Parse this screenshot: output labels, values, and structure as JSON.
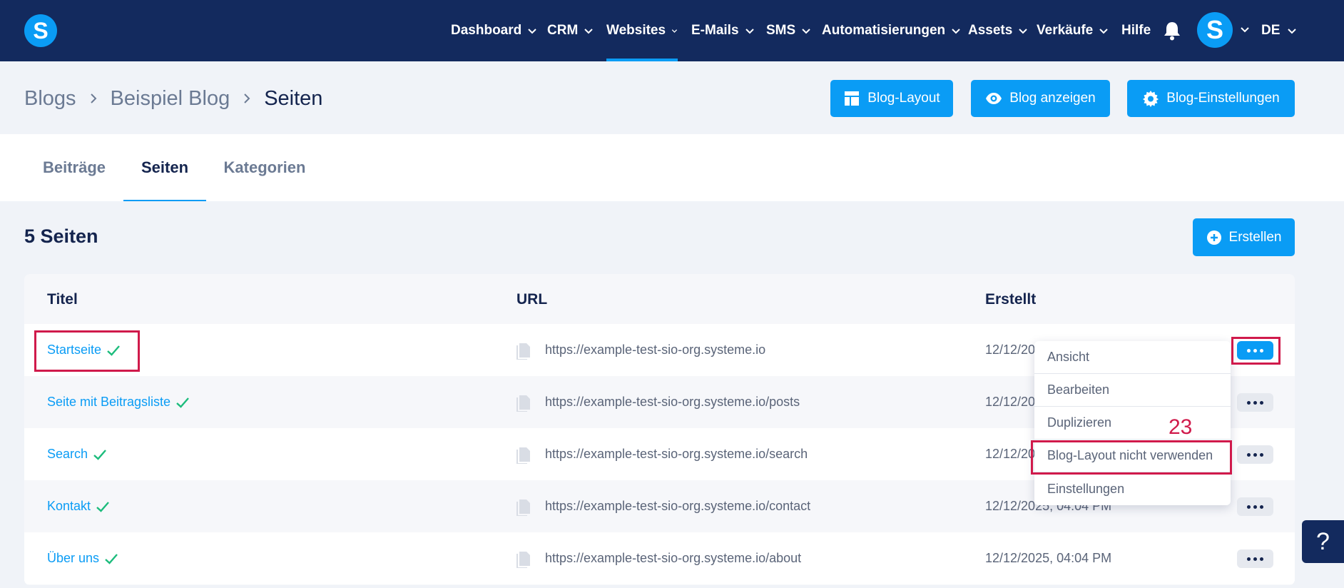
{
  "brand": {
    "logo_letter": "S",
    "accent": "#0a9cf5",
    "nav_bg": "#132a5e",
    "highlight": "#d01a4b"
  },
  "nav": {
    "items": [
      {
        "label": "Dashboard"
      },
      {
        "label": "CRM"
      },
      {
        "label": "Websites"
      },
      {
        "label": "E-Mails"
      },
      {
        "label": "SMS"
      },
      {
        "label": "Automatisierungen"
      },
      {
        "label": "Assets"
      },
      {
        "label": "Verkäufe"
      },
      {
        "label": "Hilfe"
      }
    ],
    "active": "Websites",
    "avatar_letter": "S",
    "language": "DE"
  },
  "breadcrumb": {
    "items": [
      "Blogs",
      "Beispiel Blog",
      "Seiten"
    ]
  },
  "header_buttons": {
    "blog_layout": "Blog-Layout",
    "blog_view": "Blog anzeigen",
    "blog_settings": "Blog-Einstellungen"
  },
  "tabs": {
    "items": [
      {
        "label": "Beiträge"
      },
      {
        "label": "Seiten"
      },
      {
        "label": "Kategorien"
      }
    ],
    "active": "Seiten"
  },
  "section": {
    "title": "5 Seiten",
    "create_label": "Erstellen"
  },
  "table": {
    "headers": {
      "title": "Titel",
      "url": "URL",
      "created": "Erstellt"
    },
    "rows": [
      {
        "title": "Startseite",
        "url": "https://example-test-sio-org.systeme.io",
        "created": "12/12/20"
      },
      {
        "title": "Seite mit Beitragsliste",
        "url": "https://example-test-sio-org.systeme.io/posts",
        "created": "12/12/20"
      },
      {
        "title": "Search",
        "url": "https://example-test-sio-org.systeme.io/search",
        "created": "12/12/20"
      },
      {
        "title": "Kontakt",
        "url": "https://example-test-sio-org.systeme.io/contact",
        "created": "12/12/2025, 04:04 PM"
      },
      {
        "title": "Über uns",
        "url": "https://example-test-sio-org.systeme.io/about",
        "created": "12/12/2025, 04:04 PM"
      }
    ]
  },
  "menu": {
    "items": [
      {
        "label": "Ansicht"
      },
      {
        "label": "Bearbeiten"
      },
      {
        "label": "Duplizieren"
      },
      {
        "label": "Blog-Layout nicht verwenden"
      },
      {
        "label": "Einstellungen"
      }
    ]
  },
  "annotation": {
    "label": "23"
  },
  "help": {
    "label": "?"
  }
}
